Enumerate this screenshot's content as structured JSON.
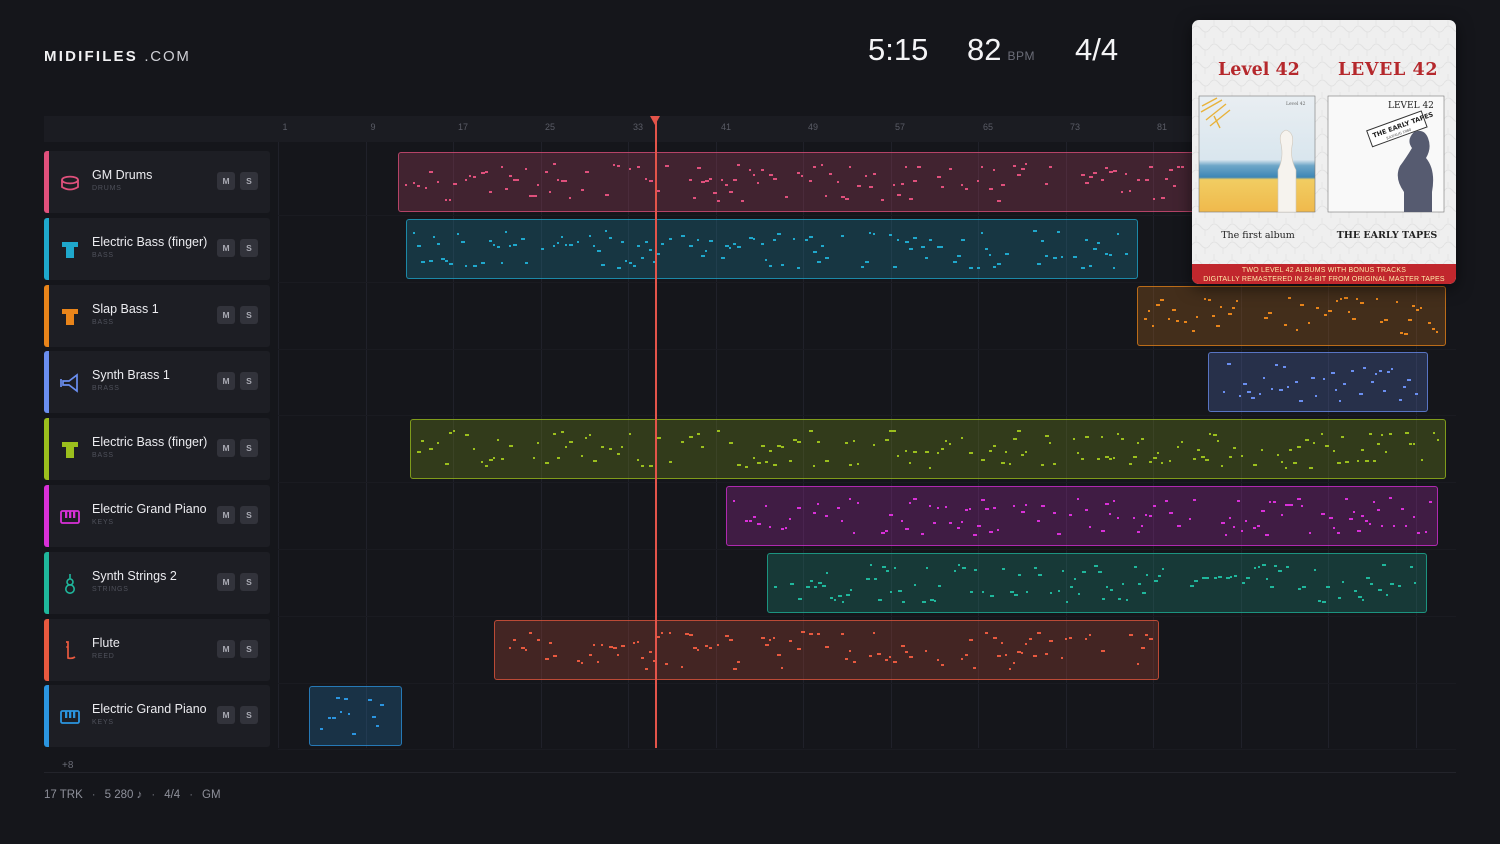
{
  "brand": {
    "bold": "MIDIFILES",
    "light": ".COM"
  },
  "hud": {
    "time": "5:15",
    "tempo": "82",
    "tempo_unit": "BPM",
    "meter": "4/4"
  },
  "ruler": {
    "labels": [
      "1",
      "9",
      "17",
      "25",
      "33",
      "41",
      "49",
      "57",
      "65",
      "73",
      "81"
    ]
  },
  "tracks": [
    {
      "name": "GM Drums",
      "category": "DRUMS",
      "color": "#e0507c",
      "icon": "drum-icon"
    },
    {
      "name": "Electric Bass (finger)",
      "category": "BASS",
      "color": "#1fa8cc",
      "icon": "bass-icon"
    },
    {
      "name": "Slap Bass 1",
      "category": "BASS",
      "color": "#e8841a",
      "icon": "bass-icon"
    },
    {
      "name": "Synth Brass 1",
      "category": "BRASS",
      "color": "#6a8ef0",
      "icon": "horn-icon"
    },
    {
      "name": "Electric Bass (finger)",
      "category": "BASS",
      "color": "#9bbf1d",
      "icon": "bass-icon"
    },
    {
      "name": "Electric Grand Piano",
      "category": "KEYS",
      "color": "#d930d8",
      "icon": "keyboard-icon"
    },
    {
      "name": "Synth Strings 2",
      "category": "STRINGS",
      "color": "#1fb79c",
      "icon": "violin-icon"
    },
    {
      "name": "Flute",
      "category": "REED",
      "color": "#e8593f",
      "icon": "flute-icon"
    },
    {
      "name": "Electric Grand Piano",
      "category": "KEYS",
      "color": "#2b95e0",
      "icon": "keyboard-icon"
    }
  ],
  "buttons": {
    "mute": "M",
    "solo": "S"
  },
  "more_tracks": "+8",
  "footer": {
    "tracks": "17 TRK",
    "notes": "5 280 ♪",
    "meter": "4/4",
    "standard": "GM"
  },
  "album": {
    "left_title": "Level 42",
    "right_title": "LEVEL 42",
    "left_caption": "The first album",
    "right_caption": "THE EARLY TAPES",
    "right_inner_title": "LEVEL 42",
    "left_inner_title": "Level 42",
    "stamp": "THE EARLY TAPES",
    "stamp_dates": "JULY/AUG 1980",
    "band_line1": "TWO LEVEL 42 ALBUMS WITH BONUS TRACKS",
    "band_line2": "DIGITALLY REMASTERED IN 24-BIT FROM ORIGINAL MASTER TAPES"
  }
}
